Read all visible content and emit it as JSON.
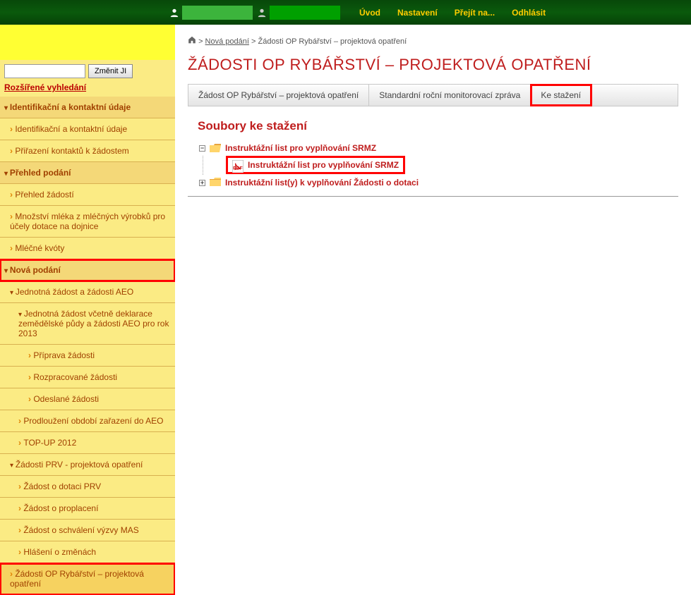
{
  "topbar": {
    "links": [
      "Úvod",
      "Nastavení",
      "Přejít na...",
      "Odhlásit"
    ]
  },
  "sidebar": {
    "btn_change": "Změnit JI",
    "adv_search": "Rozšířené vyhledání",
    "nav": {
      "ident_header": "Identifikační a kontaktní údaje",
      "ident_item1": "Identifikační a kontaktní údaje",
      "ident_item2": "Přiřazení kontaktů k žádostem",
      "prehled_header": "Přehled podání",
      "prehled_item1": "Přehled žádostí",
      "prehled_item2": "Množství mléka z mléčných výrobků pro účely dotace na dojnice",
      "prehled_item3": "Mléčné kvóty",
      "nova_header": "Nová podání",
      "nova_jedn_header": "Jednotná žádost a žádosti AEO",
      "nova_jedn_sub": "Jednotná žádost včetně deklarace zemědělské půdy a žádosti AEO pro rok 2013",
      "nova_jedn_i1": "Příprava žádosti",
      "nova_jedn_i2": "Rozpracované žádosti",
      "nova_jedn_i3": "Odeslané žádosti",
      "nova_prodl": "Prodloužení období zařazení do AEO",
      "nova_topup": "TOP-UP 2012",
      "nova_prv_header": "Žádosti PRV - projektová opatření",
      "nova_prv_i1": "Žádost o dotaci PRV",
      "nova_prv_i2": "Žádost o proplacení",
      "nova_prv_i3": "Žádost o schválení výzvy MAS",
      "nova_prv_i4": "Hlášení o změnách",
      "nova_ryb": "Žádosti OP Rybářství – projektová opatření"
    }
  },
  "breadcrumb": {
    "sep1": " > ",
    "nova": "Nová podání",
    "sep2": " > ",
    "current": "Žádosti OP Rybářství – projektová opatření"
  },
  "title": "ŽÁDOSTI OP RYBÁŘSTVÍ – PROJEKTOVÁ OPATŘENÍ",
  "tabs": {
    "t1": "Žádost OP Rybářství – projektová opatření",
    "t2": "Standardní roční monitorovací zpráva",
    "t3": "Ke stažení"
  },
  "subtitle": "Soubory ke stažení",
  "tree": {
    "folder1": "Instruktážní list pro vyplňování SRMZ",
    "file1": "Instruktážní list pro vyplňování SRMZ",
    "folder2": "Instruktážní list(y) k vyplňování Žádosti o dotaci"
  },
  "icons": {
    "toggle_minus": "−",
    "toggle_plus": "+"
  }
}
